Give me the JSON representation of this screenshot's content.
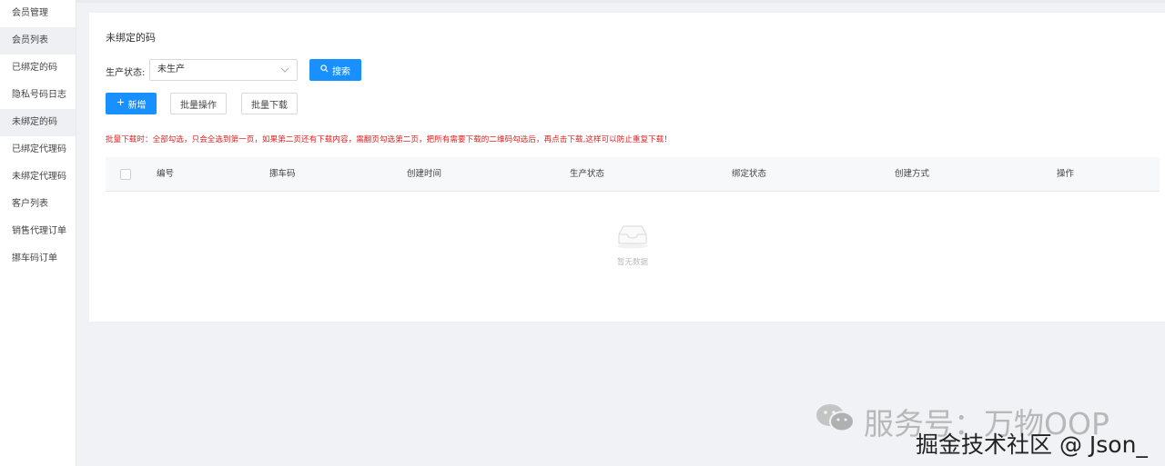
{
  "sidebar": {
    "items": [
      {
        "label": "会员管理"
      },
      {
        "label": "会员列表",
        "active": true
      },
      {
        "label": "已绑定的码"
      },
      {
        "label": "隐私号码日志"
      },
      {
        "label": "未绑定的码",
        "active": true
      },
      {
        "label": "已绑定代理码"
      },
      {
        "label": "未绑定代理码"
      },
      {
        "label": "客户列表"
      },
      {
        "label": "销售代理订单"
      },
      {
        "label": "挪车码订单"
      }
    ]
  },
  "page": {
    "title": "未绑定的码",
    "filter_label": "生产状态:",
    "filter_value": "未生产",
    "search_label": "搜索",
    "add_label": "新增",
    "batch_op_label": "批量操作",
    "batch_download_label": "批量下载",
    "warning": "批量下载时：全部勾选，只会全选到第一页，如果第二页还有下载内容，需翻页勾选第二页，把所有需要下载的二维码勾选后，再点击下载,这样可以防止重复下载！"
  },
  "table": {
    "columns": [
      "编号",
      "挪车码",
      "创建时间",
      "生产状态",
      "绑定状态",
      "创建方式",
      "操作"
    ],
    "rows": [],
    "empty_text": "暂无数据"
  },
  "watermark": {
    "line1": "服务号：万物OOP",
    "line2": "掘金技术社区 @ Json_"
  },
  "colors": {
    "primary": "#1890ff",
    "warning": "#e02020",
    "background": "#f0f2f5"
  },
  "icons": [
    "search-icon",
    "plus-icon",
    "chevron-down-icon",
    "empty-inbox-icon",
    "wechat-icon"
  ]
}
